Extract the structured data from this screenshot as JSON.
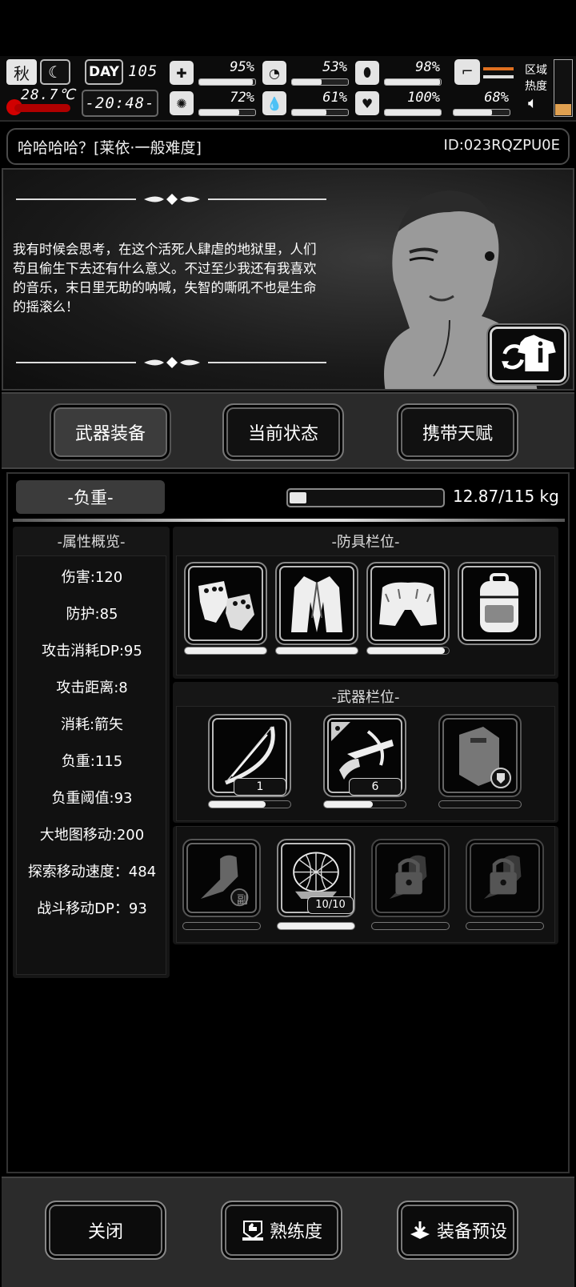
{
  "hud": {
    "season": "秋",
    "temperature": "28.7℃",
    "day_label": "DAY",
    "day_number": "105",
    "time": "-20:48-",
    "stats": [
      {
        "name": "health",
        "icon": "medkit-icon",
        "value": "95%",
        "fill": 0.95
      },
      {
        "name": "hunger",
        "icon": "stomach-icon",
        "value": "53%",
        "fill": 0.53
      },
      {
        "name": "pill",
        "icon": "pill-icon",
        "value": "98%",
        "fill": 0.98
      },
      {
        "name": "sanity",
        "icon": "brain-icon",
        "value": "72%",
        "fill": 0.72
      },
      {
        "name": "thirst",
        "icon": "water-drop-icon",
        "value": "61%",
        "fill": 0.61
      },
      {
        "name": "mood",
        "icon": "heart-icon",
        "value": "100%",
        "fill": 1.0
      },
      {
        "name": "stamina",
        "icon": "boot-icon",
        "value": "68%",
        "fill": 0.68
      }
    ],
    "area_heat_label": "区域热度"
  },
  "profile": {
    "name_line": "哈哈哈哈？[莱依·一般难度]",
    "id": "ID:023RQZPU0E"
  },
  "story": {
    "text": "我有时候会思考，在这个活死人肆虐的地狱里，人们苟且偷生下去还有什么意义。不过至少我还有我喜欢的音乐，末日里无助的呐喊，失智的嘶吼不也是生命的摇滚么！"
  },
  "tabs": [
    {
      "label": "武器装备",
      "active": true
    },
    {
      "label": "当前状态",
      "active": false
    },
    {
      "label": "携带天赋",
      "active": false
    }
  ],
  "weight": {
    "label": "-负重-",
    "value": "12.87/115 kg",
    "fill": 0.112
  },
  "attributes": {
    "title": "-属性概览-",
    "rows": [
      "伤害:120",
      "防护:85",
      "攻击消耗DP:95",
      "攻击距离:8",
      "消耗:箭矢",
      "负重:115",
      "负重阈值:93",
      "大地图移动:200",
      "探索移动速度：484",
      "战斗移动DP：93"
    ]
  },
  "armor": {
    "title": "-防具栏位-",
    "slots": [
      {
        "name": "gloves",
        "icon": "gloves-icon",
        "durability": 1.0
      },
      {
        "name": "fur-coat",
        "icon": "fur-coat-icon",
        "durability": 1.0
      },
      {
        "name": "fur-pants",
        "icon": "fur-pants-icon",
        "durability": 0.95
      },
      {
        "name": "backpack",
        "icon": "backpack-icon",
        "durability": null
      }
    ]
  },
  "weapons": {
    "title": "-武器栏位-",
    "slots": [
      {
        "name": "bow",
        "icon": "bow-icon",
        "count": "1",
        "durability": 0.7
      },
      {
        "name": "crossbow",
        "icon": "crossbow-icon",
        "count": "6",
        "durability": 0.6
      },
      {
        "name": "riot-shield",
        "icon": "riot-shield-icon",
        "durability": 0
      }
    ]
  },
  "accessories": {
    "slots": [
      {
        "name": "offhand",
        "icon": "offhand-fist-icon",
        "tag": "副",
        "locked": false
      },
      {
        "name": "net",
        "icon": "net-trap-icon",
        "count": "10/10",
        "locked": false
      },
      {
        "name": "locked-1",
        "icon": "lock-icon",
        "locked": true
      },
      {
        "name": "locked-2",
        "icon": "lock-icon",
        "locked": true
      }
    ]
  },
  "bottom": {
    "close": "关闭",
    "proficiency": "熟练度",
    "preset": "装备预设"
  }
}
